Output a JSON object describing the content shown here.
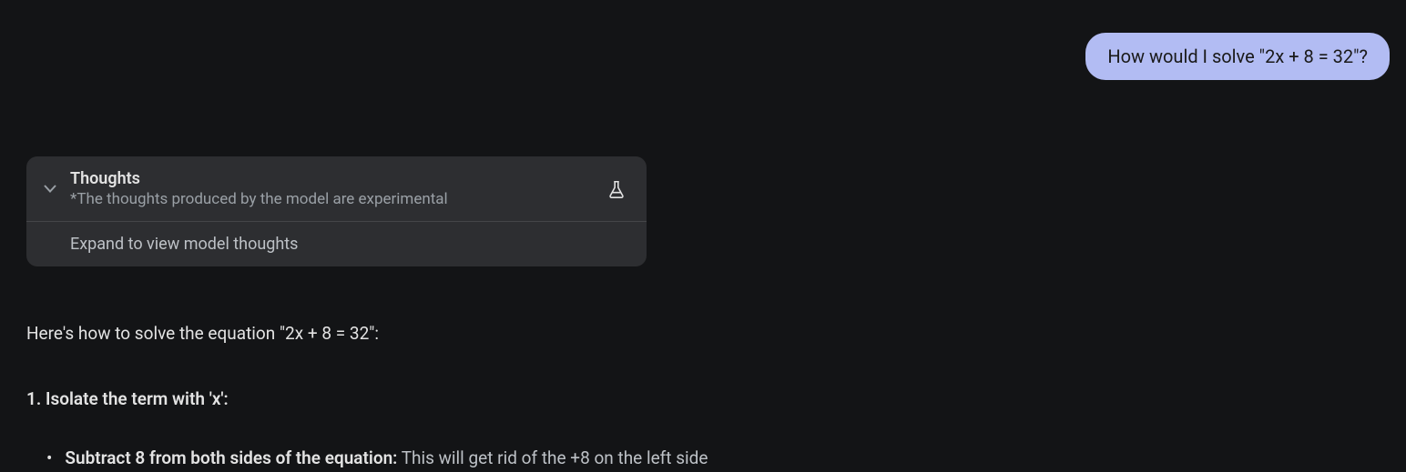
{
  "user_message": "How would I solve \"2x + 8 = 32\"?",
  "thoughts": {
    "title": "Thoughts",
    "subtitle": "*The thoughts produced by the model are experimental",
    "expand_text": "Expand to view model thoughts"
  },
  "response": {
    "intro": "Here's how to solve the equation \"2x + 8 = 32\":",
    "step1_title": "1. Isolate the term with 'x':",
    "bullet1_bold": "Subtract 8 from both sides of the equation:",
    "bullet1_rest": " This will get rid of the +8 on the left side"
  }
}
